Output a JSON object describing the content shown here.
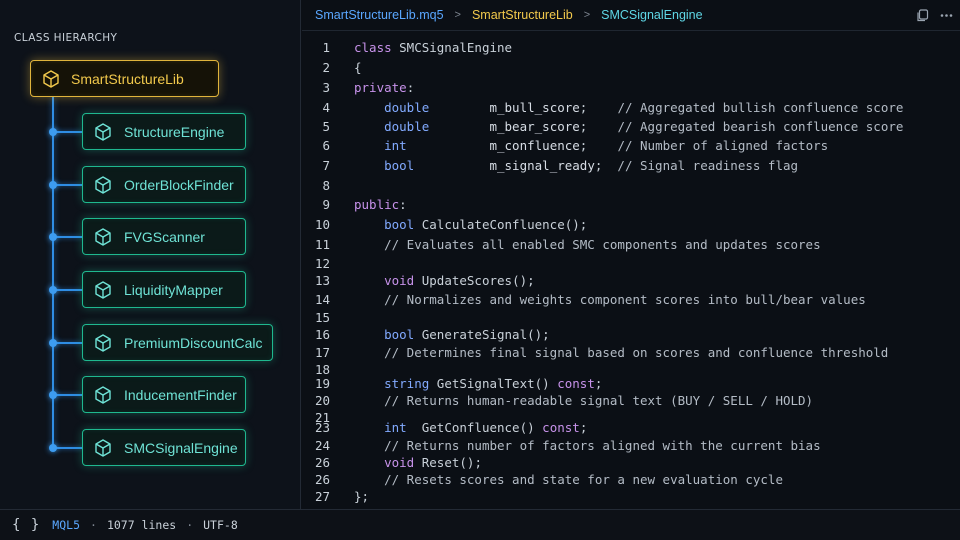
{
  "sidebar": {
    "title": "CLASS HIERARCHY",
    "root": {
      "label": "SmartStructureLib",
      "icon": "cube-icon"
    },
    "children": [
      {
        "label": "StructureEngine",
        "icon": "cube-icon"
      },
      {
        "label": "OrderBlockFinder",
        "icon": "cube-icon"
      },
      {
        "label": "FVGScanner",
        "icon": "cube-icon"
      },
      {
        "label": "LiquidityMapper",
        "icon": "cube-icon"
      },
      {
        "label": "PremiumDiscountCalc",
        "icon": "cube-icon"
      },
      {
        "label": "InducementFinder",
        "icon": "cube-icon"
      },
      {
        "label": "SMCSignalEngine",
        "icon": "cube-icon"
      }
    ]
  },
  "breadcrumb": {
    "file": "SmartStructureLib.mq5",
    "namespace": "SmartStructureLib",
    "symbol": "SMCSignalEngine",
    "separator": ">"
  },
  "tab_actions": [
    {
      "name": "copy-icon"
    },
    {
      "name": "more-icon"
    }
  ],
  "code": {
    "lines": [
      {
        "n": "1",
        "tokens": [
          [
            "kw",
            "class "
          ],
          [
            "pl",
            "SMCSignalEngine"
          ]
        ]
      },
      {
        "n": "2",
        "tokens": [
          [
            "pl",
            "{"
          ]
        ]
      },
      {
        "n": "3",
        "tokens": [
          [
            "kw",
            "private"
          ],
          [
            "pl",
            ":"
          ]
        ]
      },
      {
        "n": "4",
        "tokens": [
          [
            "pl",
            "    "
          ],
          [
            "ty",
            "double"
          ],
          [
            "pl",
            "        "
          ],
          [
            "mem",
            "m_bull_score"
          ],
          [
            "pl",
            ";    "
          ],
          [
            "cm",
            "// Aggregated bullish confluence score"
          ]
        ]
      },
      {
        "n": "5",
        "tokens": [
          [
            "pl",
            "    "
          ],
          [
            "ty",
            "double"
          ],
          [
            "pl",
            "        "
          ],
          [
            "mem",
            "m_bear_score"
          ],
          [
            "pl",
            ";    "
          ],
          [
            "cm",
            "// Aggregated bearish confluence score"
          ]
        ]
      },
      {
        "n": "6",
        "tokens": [
          [
            "pl",
            "    "
          ],
          [
            "ty",
            "int"
          ],
          [
            "pl",
            "           "
          ],
          [
            "mem",
            "m_confluence"
          ],
          [
            "pl",
            ";    "
          ],
          [
            "cm",
            "// Number of aligned factors"
          ]
        ]
      },
      {
        "n": "7",
        "tokens": [
          [
            "pl",
            "    "
          ],
          [
            "ty",
            "bool"
          ],
          [
            "pl",
            "          "
          ],
          [
            "mem",
            "m_signal_ready"
          ],
          [
            "pl",
            ";  "
          ],
          [
            "cm",
            "// Signal readiness flag"
          ]
        ]
      },
      {
        "n": "8",
        "tokens": []
      },
      {
        "n": "9",
        "tokens": [
          [
            "kw",
            "public"
          ],
          [
            "pl",
            ":"
          ]
        ]
      },
      {
        "n": "10",
        "tokens": [
          [
            "pl",
            "    "
          ],
          [
            "ty",
            "bool"
          ],
          [
            "pl",
            " "
          ],
          [
            "fn",
            "CalculateConfluence"
          ],
          [
            "pl",
            "();"
          ]
        ]
      },
      {
        "n": "11",
        "tokens": [
          [
            "pl",
            "    "
          ],
          [
            "cm",
            "// Evaluates all enabled SMC components and updates scores"
          ]
        ]
      },
      {
        "n": "12",
        "tokens": []
      },
      {
        "n": "13",
        "tokens": [
          [
            "pl",
            "    "
          ],
          [
            "kw",
            "void"
          ],
          [
            "pl",
            " "
          ],
          [
            "fn",
            "UpdateScores"
          ],
          [
            "pl",
            "();"
          ]
        ]
      },
      {
        "n": "14",
        "tokens": [
          [
            "pl",
            "    "
          ],
          [
            "cm",
            "// Normalizes and weights component scores into bull/bear values"
          ]
        ]
      },
      {
        "n": "15",
        "tokens": []
      },
      {
        "n": "16",
        "tokens": [
          [
            "pl",
            "    "
          ],
          [
            "ty",
            "bool"
          ],
          [
            "pl",
            " "
          ],
          [
            "fn",
            "GenerateSignal"
          ],
          [
            "pl",
            "();"
          ]
        ]
      },
      {
        "n": "17",
        "tokens": [
          [
            "pl",
            "    "
          ],
          [
            "cm",
            "// Determines final signal based on scores and confluence threshold"
          ]
        ]
      },
      {
        "n": "18",
        "tokens": []
      },
      {
        "n": "19",
        "tokens": [
          [
            "pl",
            "    "
          ],
          [
            "ty",
            "string"
          ],
          [
            "pl",
            " "
          ],
          [
            "fn",
            "GetSignalText"
          ],
          [
            "pl",
            "() "
          ],
          [
            "kw",
            "const"
          ],
          [
            "pl",
            ";"
          ]
        ]
      },
      {
        "n": "20",
        "tokens": [
          [
            "pl",
            "    "
          ],
          [
            "cm",
            "// Returns human-readable signal text (BUY / SELL / HOLD)"
          ]
        ]
      },
      {
        "n": "21",
        "tokens": []
      },
      {
        "n": "23",
        "tokens": [
          [
            "pl",
            "    "
          ],
          [
            "ty",
            "int"
          ],
          [
            "pl",
            "  "
          ],
          [
            "fn",
            "GetConfluence"
          ],
          [
            "pl",
            "() "
          ],
          [
            "kw",
            "const"
          ],
          [
            "pl",
            ";"
          ]
        ]
      },
      {
        "n": "24",
        "tokens": [
          [
            "pl",
            "    "
          ],
          [
            "cm",
            "// Returns number of factors aligned with the current bias"
          ]
        ]
      },
      {
        "n": "26",
        "tokens": [
          [
            "pl",
            "    "
          ],
          [
            "kw",
            "void"
          ],
          [
            "pl",
            " "
          ],
          [
            "fn",
            "Reset"
          ],
          [
            "pl",
            "();"
          ]
        ]
      },
      {
        "n": "26",
        "tokens": [
          [
            "pl",
            "    "
          ],
          [
            "cm",
            "// Resets scores and state for a new evaluation cycle"
          ]
        ]
      },
      {
        "n": "27",
        "tokens": [
          [
            "pl",
            "};"
          ]
        ]
      }
    ]
  },
  "statusbar": {
    "icon": "{ }",
    "language": "MQL5",
    "lines": "1077 lines",
    "encoding": "UTF-8",
    "separator": "·"
  }
}
